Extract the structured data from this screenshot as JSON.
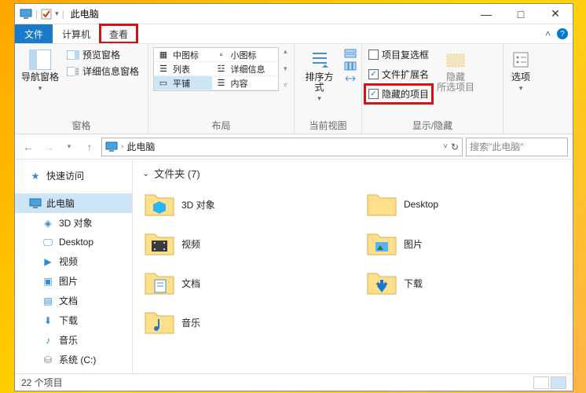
{
  "titlebar": {
    "title": "此电脑"
  },
  "window_controls": {
    "min": "—",
    "max": "□",
    "close": "✕"
  },
  "tabs": {
    "file": "文件",
    "computer": "计算机",
    "view": "查看"
  },
  "ribbon": {
    "panes": {
      "navpane": "导航窗格",
      "preview": "预览窗格",
      "details": "详细信息窗格",
      "group_label": "窗格"
    },
    "layout": {
      "opts": [
        "中图标",
        "小图标",
        "列表",
        "详细信息",
        "平铺",
        "内容"
      ],
      "group_label": "布局"
    },
    "currentview": {
      "sort": "排序方式",
      "group_label": "当前视图"
    },
    "showhide": {
      "check_boxes": "项目复选框",
      "ext": "文件扩展名",
      "hidden": "隐藏的项目",
      "hide_btn": "隐藏",
      "hide_btn2": "所选项目",
      "group_label": "显示/隐藏"
    },
    "options": {
      "label": "选项"
    }
  },
  "address": {
    "location": "此电脑"
  },
  "search": {
    "placeholder": "搜索\"此电脑\""
  },
  "nav": {
    "quick": "快速访问",
    "thispc": "此电脑",
    "items": [
      "3D 对象",
      "Desktop",
      "视频",
      "图片",
      "文档",
      "下载",
      "音乐",
      "系统 (C:)"
    ]
  },
  "content": {
    "section": "文件夹 (7)",
    "items": [
      "3D 对象",
      "Desktop",
      "视频",
      "图片",
      "文档",
      "下载",
      "音乐"
    ]
  },
  "status": {
    "text": "22 个项目"
  }
}
